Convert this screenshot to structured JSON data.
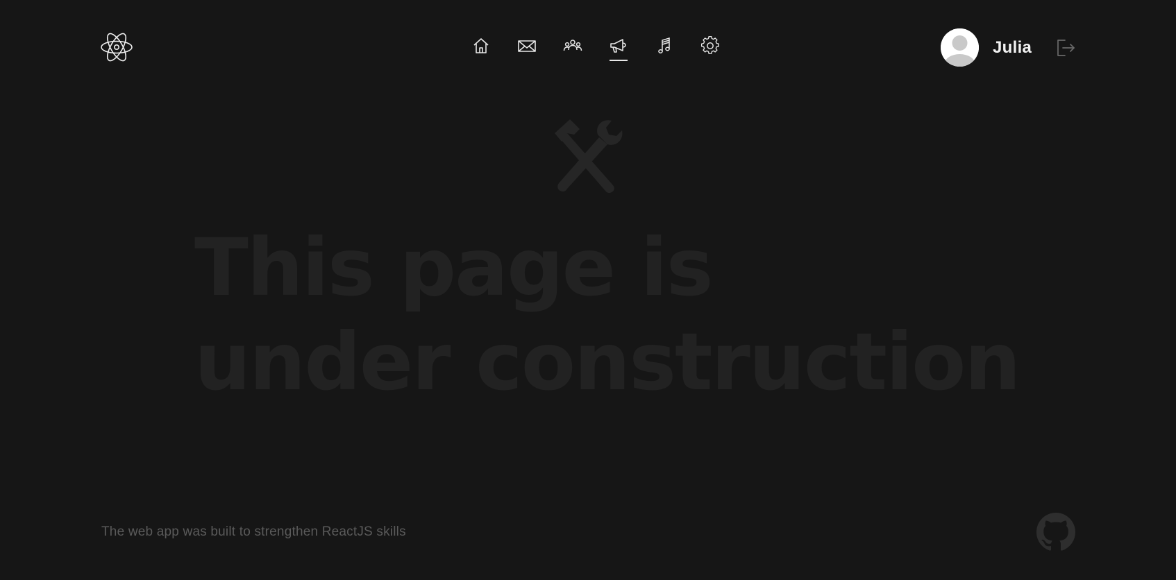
{
  "header": {
    "logo_icon": "react-atom-icon",
    "nav": [
      {
        "name": "home",
        "icon": "home-icon",
        "active": false
      },
      {
        "name": "messages",
        "icon": "mail-icon",
        "active": false
      },
      {
        "name": "friends",
        "icon": "users-icon",
        "active": false
      },
      {
        "name": "news",
        "icon": "megaphone-icon",
        "active": true
      },
      {
        "name": "music",
        "icon": "music-icon",
        "active": false
      },
      {
        "name": "settings",
        "icon": "gear-icon",
        "active": false
      }
    ],
    "user": {
      "name": "Julia",
      "avatar_icon": "default-avatar-icon"
    },
    "logout_icon": "logout-icon"
  },
  "main": {
    "tools_icon": "hammer-wrench-icon",
    "headline_line1": "This page is",
    "headline_line2": "under construction"
  },
  "footer": {
    "text": "The web app was built to strengthen ReactJS skills",
    "github_icon": "github-icon"
  },
  "colors": {
    "background": "#161616",
    "nav_icon": "#e8e8e8",
    "headline": "#222222",
    "footer_text": "#5a5a5a",
    "logout_icon": "#6a6a6a",
    "github_icon": "#2e2e2e"
  }
}
